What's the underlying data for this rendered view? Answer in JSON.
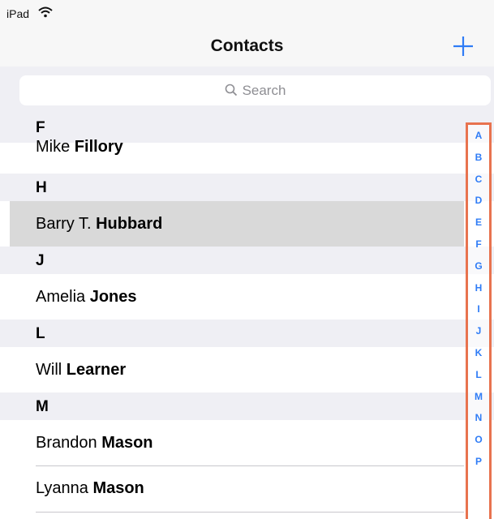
{
  "status_bar": {
    "carrier": "iPad",
    "wifi_icon": "wifi-icon"
  },
  "nav_bar": {
    "title": "Contacts",
    "add_icon": "plus-icon"
  },
  "search": {
    "placeholder": "Search",
    "icon": "search-icon"
  },
  "sections": [
    {
      "letter": "F",
      "contacts": [
        {
          "first": "Mike",
          "last": "Fillory"
        }
      ]
    },
    {
      "letter": "H",
      "contacts": [
        {
          "first": "Barry T.",
          "last": "Hubbard",
          "selected": true
        }
      ]
    },
    {
      "letter": "J",
      "contacts": [
        {
          "first": "Amelia",
          "last": "Jones"
        }
      ]
    },
    {
      "letter": "L",
      "contacts": [
        {
          "first": "Will",
          "last": "Learner"
        }
      ]
    },
    {
      "letter": "M",
      "contacts": [
        {
          "first": "Brandon",
          "last": "Mason"
        },
        {
          "first": "Lyanna",
          "last": "Mason"
        }
      ]
    }
  ],
  "index_letters": [
    "A",
    "B",
    "C",
    "D",
    "E",
    "F",
    "G",
    "H",
    "I",
    "J",
    "K",
    "L",
    "M",
    "N",
    "O",
    "P"
  ],
  "colors": {
    "accent": "#2f7cf6",
    "highlight_border": "#e8734f",
    "section_bg": "#efeff4",
    "selected_row": "#d9d9d9"
  }
}
